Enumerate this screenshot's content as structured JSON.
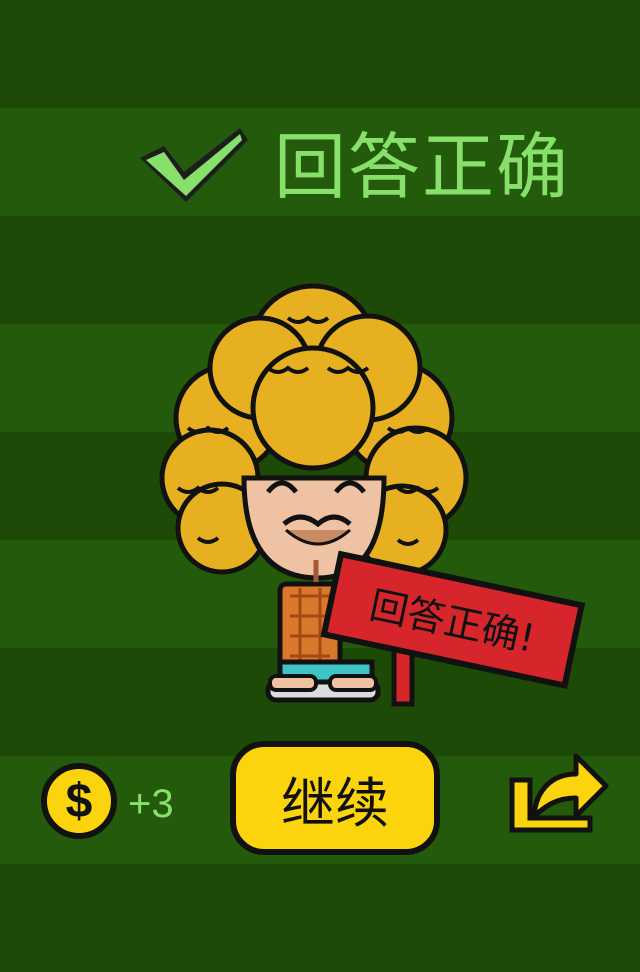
{
  "header": {
    "title": "回答正确"
  },
  "character": {
    "sign_text": "回答正确!"
  },
  "footer": {
    "reward": "+3",
    "continue_label": "继续"
  },
  "icons": {
    "check": "check-icon",
    "coin": "dollar-coin-icon",
    "share": "share-arrow-icon"
  },
  "colors": {
    "stripe_dark": "#1d4a06",
    "stripe_light": "#245a0b",
    "accent_green": "#86e06a",
    "button_yellow": "#fbd40d",
    "hair": "#e7b021",
    "sign_red": "#d6262c"
  }
}
